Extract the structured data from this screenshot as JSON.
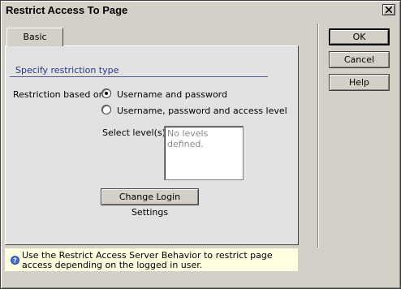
{
  "window": {
    "title": "Restrict Access To Page"
  },
  "tabs": [
    {
      "label": "Basic"
    }
  ],
  "section": {
    "legend": "Specify restriction type"
  },
  "restriction": {
    "label": "Restriction based on:",
    "options": [
      {
        "label": "Username and password",
        "selected": true
      },
      {
        "label": "Username, password and access level",
        "selected": false
      }
    ]
  },
  "levels": {
    "label": "Select level(s):",
    "placeholder": "No levels defined."
  },
  "buttons": {
    "change_login": "Change Login Settings",
    "ok": "OK",
    "cancel": "Cancel",
    "help": "Help"
  },
  "help_text": "Use the Restrict Access Server Behavior to restrict page access depending on the logged in user.",
  "colors": {
    "dialog_bg": "#d4d0c8",
    "panel_bg": "#e2e2e2",
    "legend": "#2b3a88",
    "help_bar": "#ffffe1"
  },
  "icons": [
    "close-icon",
    "help-question-icon",
    "radio-selected-icon",
    "radio-unselected-icon"
  ]
}
